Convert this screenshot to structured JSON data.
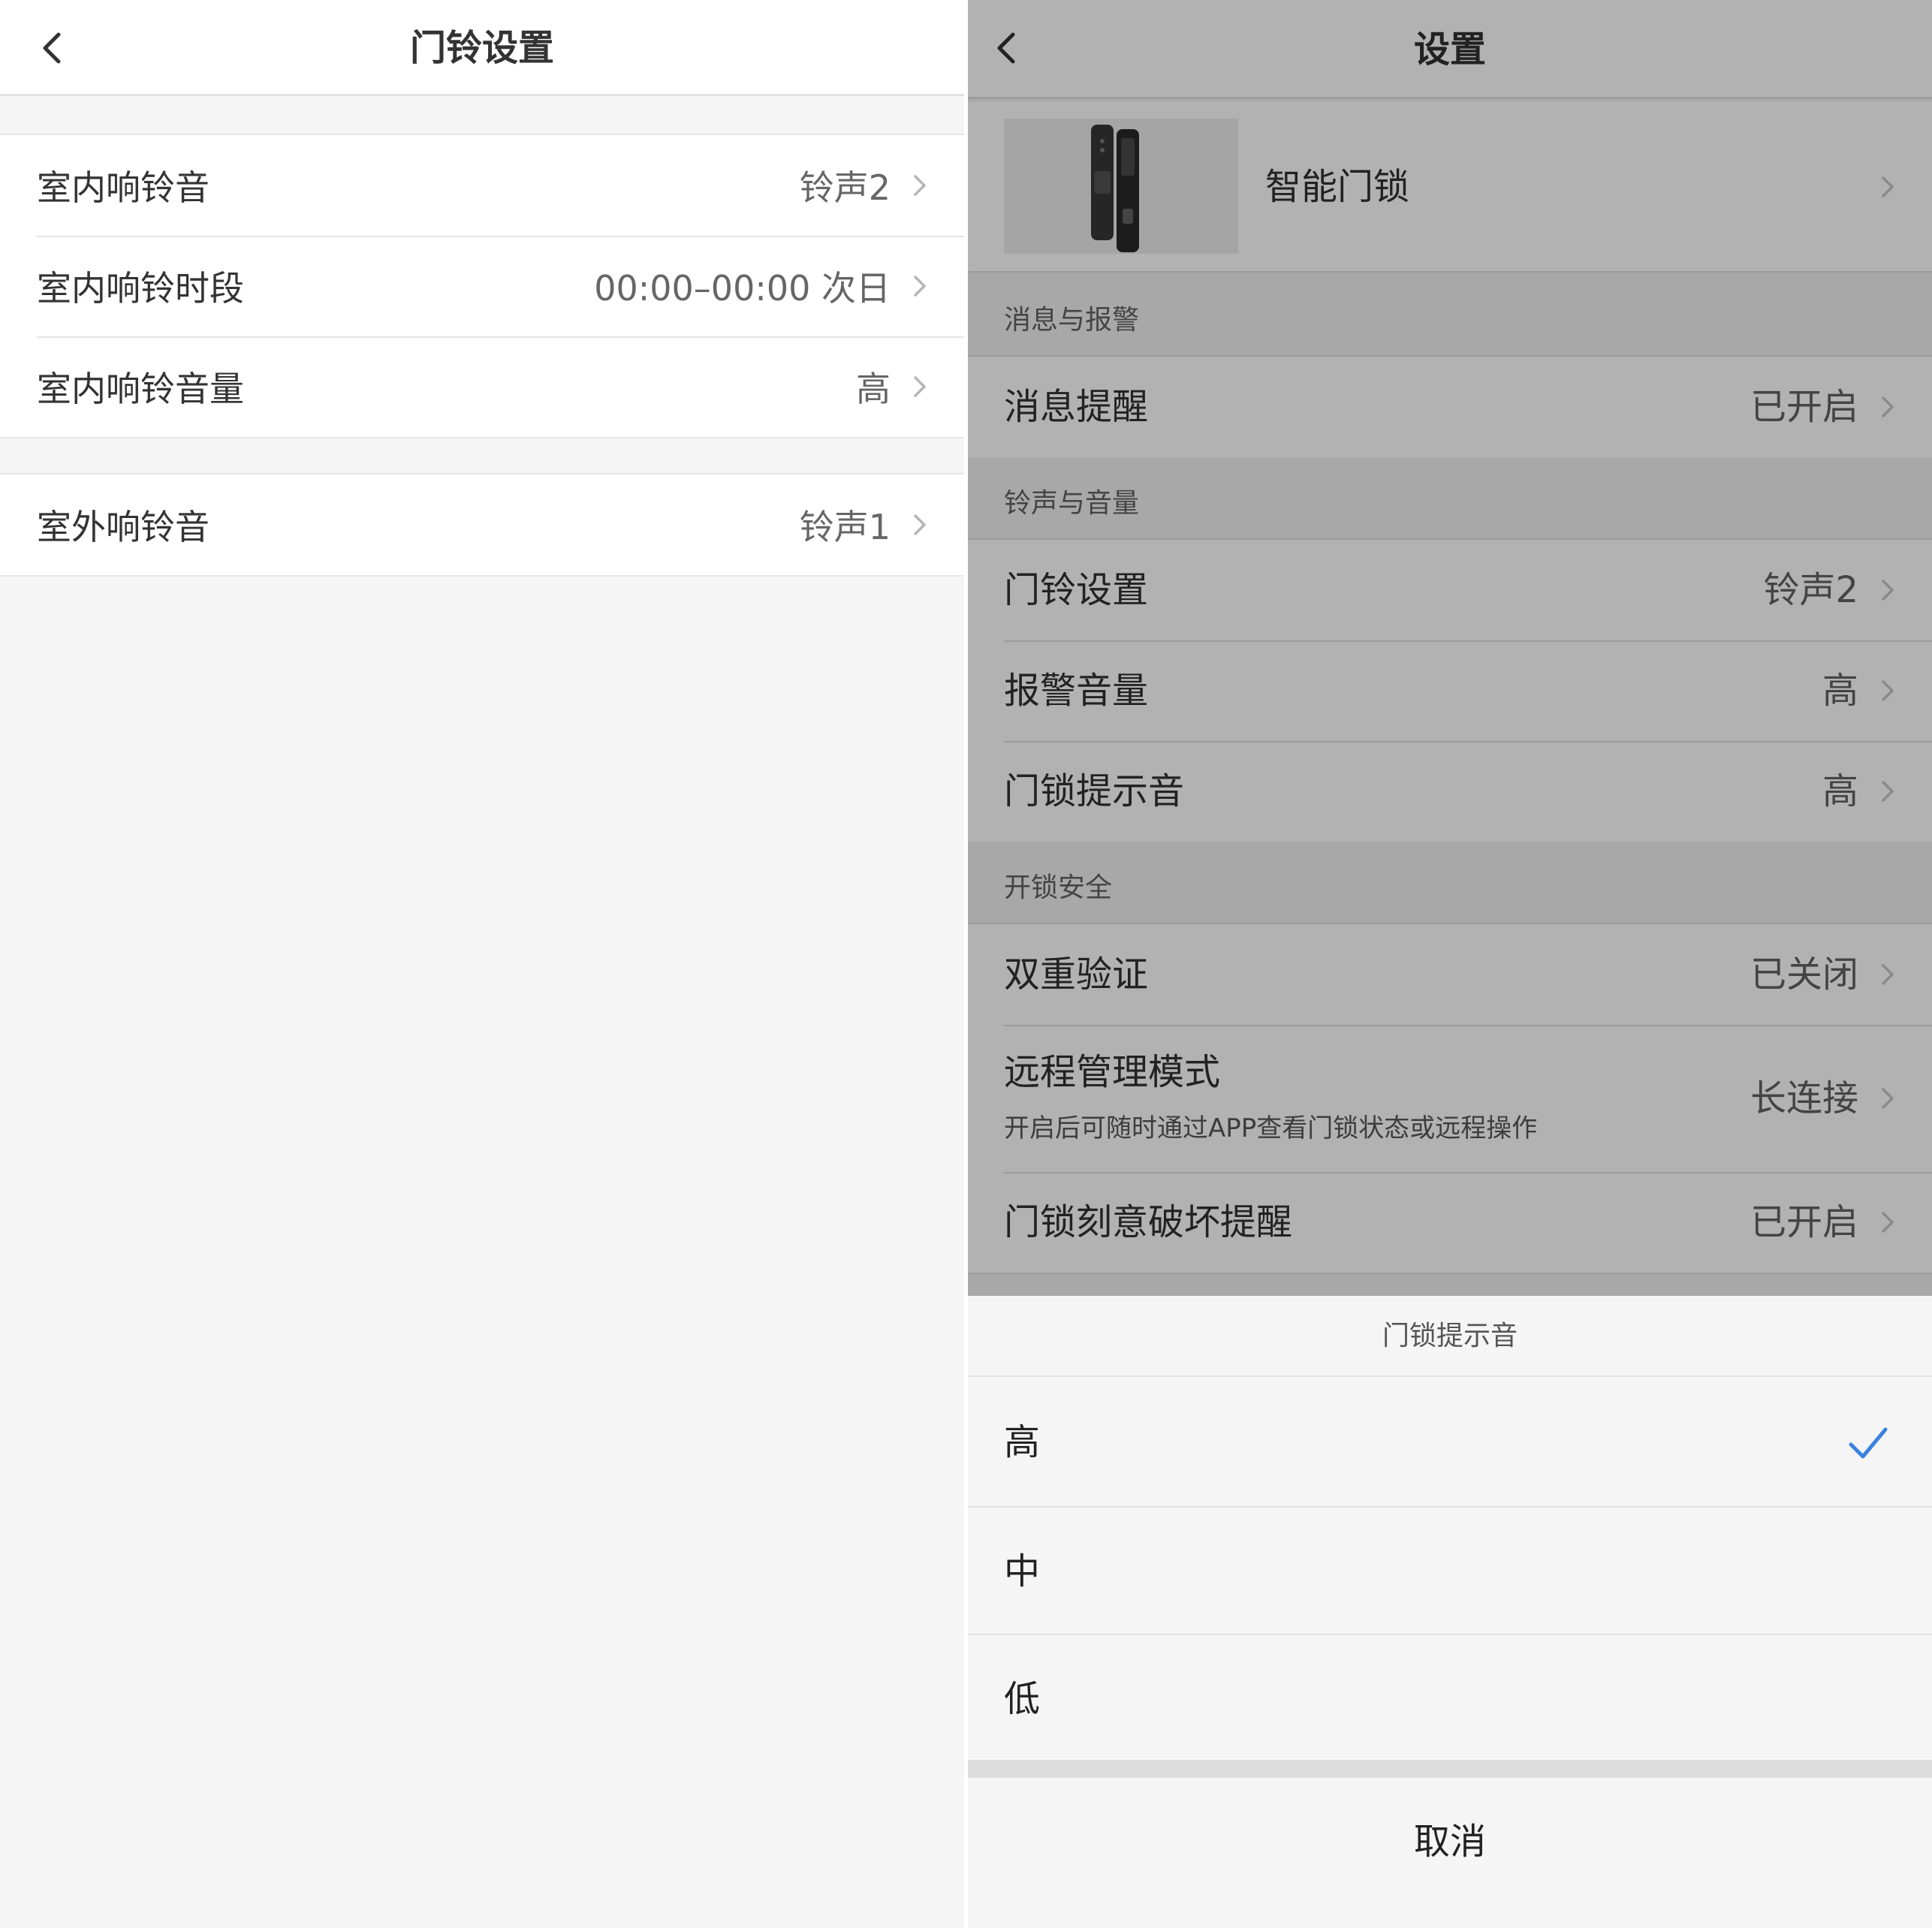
{
  "left": {
    "title": "门铃设置",
    "group1": [
      {
        "label": "室内响铃音",
        "value": "铃声2"
      },
      {
        "label": "室内响铃时段",
        "value": "00:00–00:00 次日"
      },
      {
        "label": "室内响铃音量",
        "value": "高"
      }
    ],
    "group2": [
      {
        "label": "室外响铃音",
        "value": "铃声1"
      }
    ]
  },
  "right": {
    "title": "设置",
    "device_name": "智能门锁",
    "sections": {
      "messages": {
        "header": "消息与报警",
        "rows": [
          {
            "label": "消息提醒",
            "value": "已开启"
          }
        ]
      },
      "sound": {
        "header": "铃声与音量",
        "rows": [
          {
            "label": "门铃设置",
            "value": "铃声2"
          },
          {
            "label": "报警音量",
            "value": "高"
          },
          {
            "label": "门锁提示音",
            "value": "高"
          }
        ]
      },
      "security": {
        "header": "开锁安全",
        "rows": [
          {
            "label": "双重验证",
            "value": "已关闭"
          },
          {
            "label": "远程管理模式",
            "value": "长连接",
            "sub": "开启后可随时通过APP查看门锁状态或远程操作"
          },
          {
            "label": "门锁刻意破坏提醒",
            "value": "已开启"
          }
        ]
      }
    },
    "sheet": {
      "title": "门锁提示音",
      "options": [
        "高",
        "中",
        "低"
      ],
      "selected": "高",
      "cancel": "取消"
    }
  },
  "colors": {
    "check": "#3a82e0",
    "overlay_bg": "#b2b2b2",
    "sheet_bg": "#f5f5f5"
  },
  "icons": {
    "back": "chevron-left-icon",
    "row": "chevron-right-icon",
    "selected": "checkmark-icon"
  }
}
